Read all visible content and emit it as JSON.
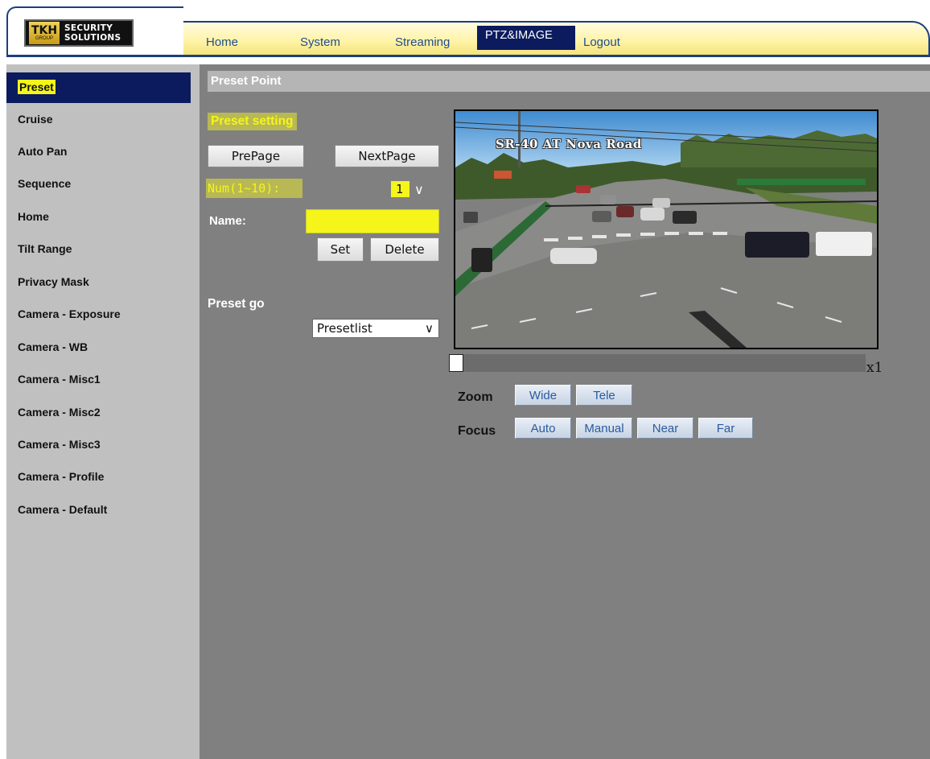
{
  "header": {
    "logo": {
      "mark": "TKH",
      "group": "GROUP",
      "line1": "SECURITY",
      "line2": "SOLUTIONS"
    },
    "nav": [
      {
        "label": "Home"
      },
      {
        "label": "System"
      },
      {
        "label": "Streaming"
      },
      {
        "label": "PTZ&IMAGE",
        "active": true
      },
      {
        "label": "Logout"
      }
    ]
  },
  "sidebar": {
    "items": [
      {
        "label": "Preset",
        "active": true
      },
      {
        "label": "Cruise"
      },
      {
        "label": "Auto Pan"
      },
      {
        "label": "Sequence"
      },
      {
        "label": "Home"
      },
      {
        "label": "Tilt Range"
      },
      {
        "label": "Privacy Mask"
      },
      {
        "label": "Camera - Exposure"
      },
      {
        "label": "Camera - WB"
      },
      {
        "label": "Camera - Misc1"
      },
      {
        "label": "Camera - Misc2"
      },
      {
        "label": "Camera - Misc3"
      },
      {
        "label": "Camera - Profile"
      },
      {
        "label": "Camera - Default"
      }
    ]
  },
  "main": {
    "section_title": "Preset Point",
    "preset_setting": {
      "title": "Preset setting",
      "prev_label": "PrePage",
      "next_label": "NextPage",
      "num_label": "Num(1~10):",
      "num_value": "1",
      "name_label": "Name:",
      "name_value": "",
      "set_label": "Set",
      "delete_label": "Delete"
    },
    "preset_go": {
      "title": "Preset go",
      "select_value": "Presetlist"
    },
    "video": {
      "caption": "SR-40 AT Nova Road"
    },
    "zoom_slider": {
      "level_text": "x1",
      "position": 0
    },
    "zoom": {
      "label": "Zoom",
      "wide": "Wide",
      "tele": "Tele"
    },
    "focus": {
      "label": "Focus",
      "auto": "Auto",
      "manual": "Manual",
      "near": "Near",
      "far": "Far"
    }
  }
}
